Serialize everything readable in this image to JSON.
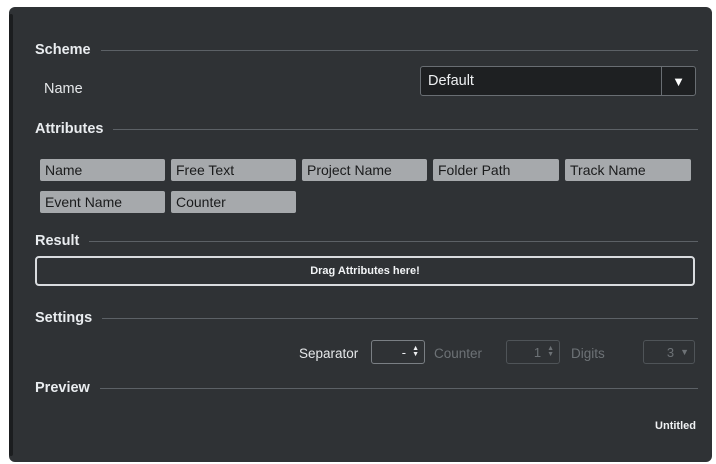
{
  "scheme": {
    "title": "Scheme",
    "name_label": "Name",
    "name_value": "Default",
    "dropdown_glyph": "▼"
  },
  "attributes": {
    "title": "Attributes",
    "items": [
      "Name",
      "Free Text",
      "Project Name",
      "Folder Path",
      "Track Name",
      "Event Name",
      "Counter"
    ]
  },
  "result": {
    "title": "Result",
    "drop_hint": "Drag Attributes here!"
  },
  "settings": {
    "title": "Settings",
    "separator_label": "Separator",
    "separator_value": "-",
    "counter_label": "Counter",
    "counter_value": "1",
    "digits_label": "Digits",
    "digits_value": "3",
    "spin_glyph_up": "▲",
    "spin_glyph_down": "▼",
    "digits_arrow": "▼"
  },
  "preview": {
    "title": "Preview",
    "value": "Untitled"
  },
  "colors": {
    "panel_bg": "#2f3235",
    "chip_bg": "#a6a9ac",
    "input_bg": "#1e2022"
  }
}
